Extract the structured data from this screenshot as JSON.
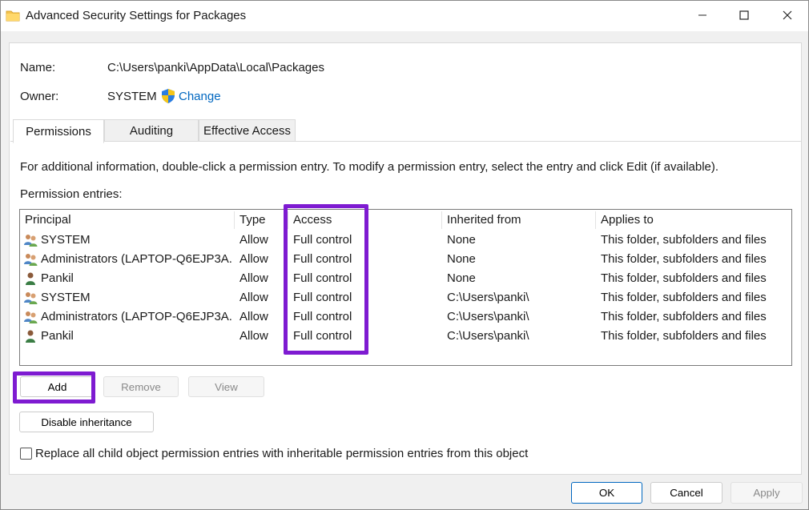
{
  "window": {
    "title": "Advanced Security Settings for Packages",
    "controls": {
      "minimize": "minimize",
      "maximize": "maximize",
      "close": "close"
    }
  },
  "header": {
    "name_label": "Name:",
    "name_value": "C:\\Users\\panki\\AppData\\Local\\Packages",
    "owner_label": "Owner:",
    "owner_value": "SYSTEM",
    "change_link": "Change"
  },
  "tabs": [
    {
      "label": "Permissions",
      "active": true
    },
    {
      "label": "Auditing",
      "active": false
    },
    {
      "label": "Effective Access",
      "active": false
    }
  ],
  "permissions": {
    "info_text": "For additional information, double-click a permission entry. To modify a permission entry, select the entry and click Edit (if available).",
    "entries_label": "Permission entries:",
    "columns": [
      "Principal",
      "Type",
      "Access",
      "Inherited from",
      "Applies to"
    ],
    "rows": [
      {
        "icon": "group-users-icon",
        "principal": "SYSTEM",
        "type": "Allow",
        "access": "Full control",
        "inherited_from": "None",
        "applies_to": "This folder, subfolders and files"
      },
      {
        "icon": "group-users-icon",
        "principal": "Administrators (LAPTOP-Q6EJP3A...",
        "type": "Allow",
        "access": "Full control",
        "inherited_from": "None",
        "applies_to": "This folder, subfolders and files"
      },
      {
        "icon": "user-icon",
        "principal": "Pankil",
        "type": "Allow",
        "access": "Full control",
        "inherited_from": "None",
        "applies_to": "This folder, subfolders and files"
      },
      {
        "icon": "group-users-icon",
        "principal": "SYSTEM",
        "type": "Allow",
        "access": "Full control",
        "inherited_from": "C:\\Users\\panki\\",
        "applies_to": "This folder, subfolders and files"
      },
      {
        "icon": "group-users-icon",
        "principal": "Administrators (LAPTOP-Q6EJP3A...",
        "type": "Allow",
        "access": "Full control",
        "inherited_from": "C:\\Users\\panki\\",
        "applies_to": "This folder, subfolders and files"
      },
      {
        "icon": "user-icon",
        "principal": "Pankil",
        "type": "Allow",
        "access": "Full control",
        "inherited_from": "C:\\Users\\panki\\",
        "applies_to": "This folder, subfolders and files"
      }
    ],
    "buttons": {
      "add": "Add",
      "remove": "Remove",
      "view": "View",
      "disable_inheritance": "Disable inheritance"
    },
    "replace_checkbox": {
      "label": "Replace all child object permission entries with inheritable permission entries from this object",
      "checked": false
    }
  },
  "footer": {
    "ok": "OK",
    "cancel": "Cancel",
    "apply": "Apply"
  },
  "colors": {
    "highlight": "#7e1bd1",
    "link": "#0067c0",
    "accent_border": "#0067c0"
  }
}
